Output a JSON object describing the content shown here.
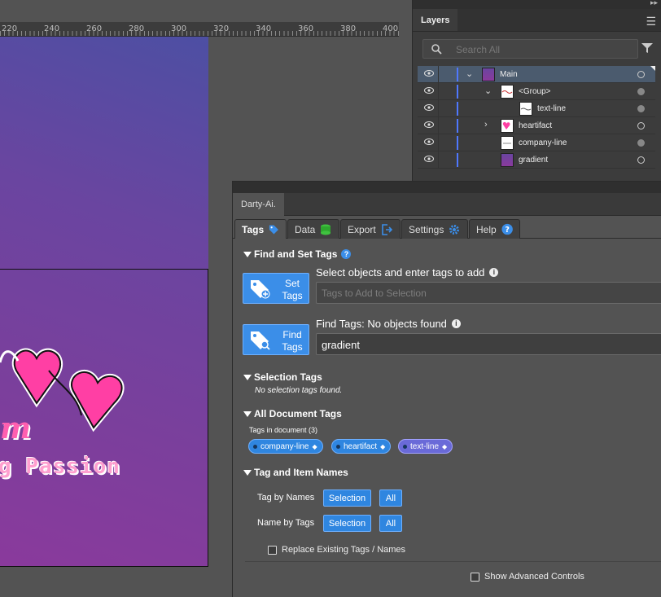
{
  "ruler": {
    "ticks": [
      "220",
      "240",
      "260",
      "280",
      "300",
      "320",
      "340",
      "360",
      "380",
      "400"
    ]
  },
  "artboard": {
    "script_text": "m",
    "tagline": "g Passion"
  },
  "layers": {
    "tab_label": "Layers",
    "search_placeholder": "Search All",
    "rows": [
      {
        "name": "Main",
        "selected": true,
        "expanded": true
      },
      {
        "name": "<Group>",
        "expanded": true
      },
      {
        "name": "text-line"
      },
      {
        "name": "heartifact",
        "expanded": false
      },
      {
        "name": "company-line"
      },
      {
        "name": "gradient"
      }
    ]
  },
  "panel": {
    "title": "Darty-Ai.",
    "tabs": [
      "Tags",
      "Data",
      "Export",
      "Settings",
      "Help"
    ],
    "find_set": {
      "heading": "Find and Set Tags",
      "set_label_1": "Set",
      "set_label_2": "Tags",
      "set_prompt": "Select objects and enter tags to add",
      "set_placeholder": "Tags to Add to Selection",
      "find_label_1": "Find",
      "find_label_2": "Tags",
      "find_prompt": "Find Tags: No objects found",
      "find_value": "gradient"
    },
    "selection_tags": {
      "heading": "Selection Tags",
      "note": "No selection tags found."
    },
    "document_tags": {
      "heading": "All Document Tags",
      "count_label": "Tags in document (3)",
      "tags": [
        "company-line",
        "heartifact",
        "text-line"
      ]
    },
    "tag_item_names": {
      "heading": "Tag and Item Names",
      "tag_by_names": "Tag by Names",
      "name_by_tags": "Name by Tags",
      "selection": "Selection",
      "all": "All",
      "replace_label": "Replace Existing Tags / Names"
    },
    "advanced_label": "Show Advanced Controls"
  },
  "colors": {
    "accent": "#3b8ee8",
    "layer_bar": "#4f78ff",
    "artboard_top": "#4d4fa3",
    "artboard_bottom": "#8a3a9c"
  }
}
